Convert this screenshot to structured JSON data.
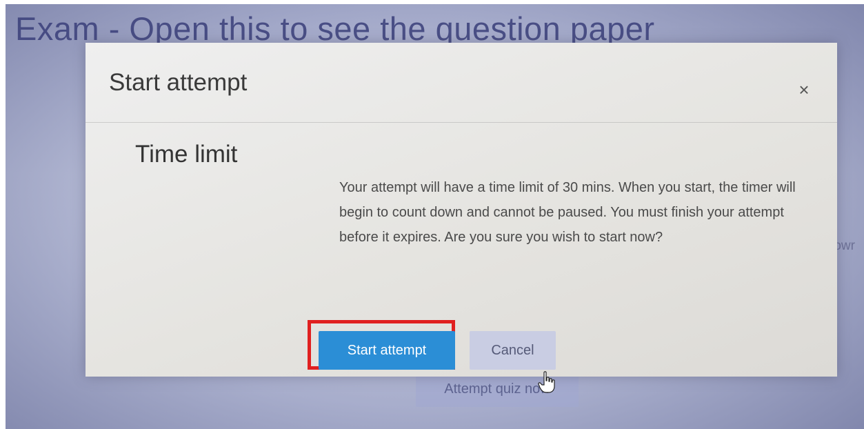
{
  "page": {
    "title": "Exam - Open this to see the question paper",
    "side_text": "rowr",
    "attempt_button": "Attempt quiz now"
  },
  "modal": {
    "title": "Start attempt",
    "close_label": "×",
    "section_heading": "Time limit",
    "body": "Your attempt will have a time limit of 30 mins. When you start, the timer will begin to count down and cannot be paused. You must finish your attempt before it expires. Are you sure you wish to start now?",
    "start_label": "Start attempt",
    "cancel_label": "Cancel"
  },
  "colors": {
    "primary": "#2b8ed6",
    "highlight": "#e02020"
  },
  "icons": {
    "cursor": "hand-pointer-icon",
    "close": "close-icon"
  }
}
